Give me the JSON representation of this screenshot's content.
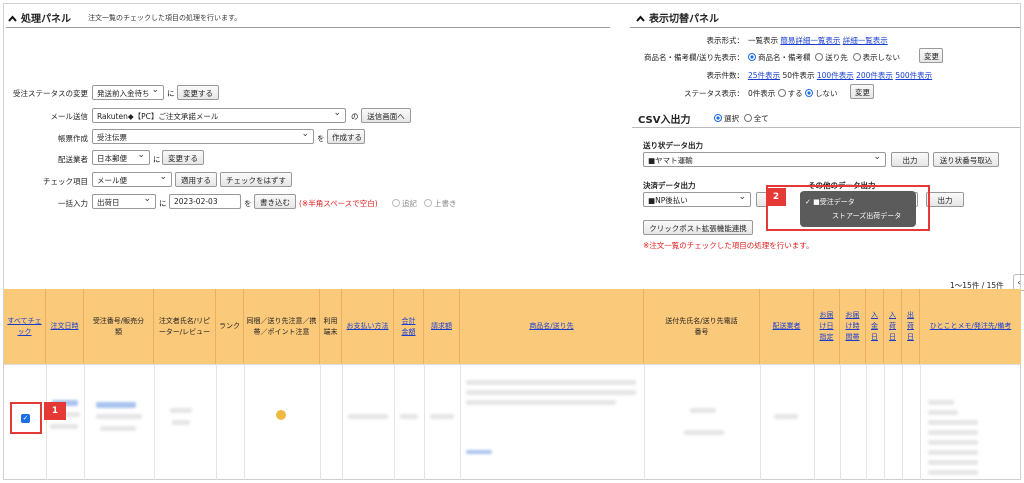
{
  "process_panel": {
    "title": "処理パネル",
    "subtitle": "注文一覧のチェックした項目の処理を行います。",
    "rows": {
      "status": {
        "label": "受注ステータスの変更",
        "select": "発送前入金待ち",
        "joiner": "に",
        "button": "変更する"
      },
      "mail": {
        "label": "メール送信",
        "select": "Rakuten◆【PC】ご注文承諾メール",
        "joiner": "の",
        "button": "送信画面へ"
      },
      "form": {
        "label": "帳票作成",
        "select": "受注伝票",
        "joiner": "を",
        "button": "作成する"
      },
      "carrier": {
        "label": "配送業者",
        "select": "日本郵便",
        "joiner": "に",
        "button": "変更する"
      },
      "check": {
        "label": "チェック項目",
        "select": "メール便",
        "button1": "適用する",
        "button2": "チェックをはずす"
      },
      "bulk": {
        "label": "一括入力",
        "select": "出荷日",
        "joiner": "に",
        "date_value": "2023-02-03",
        "joiner2": "を",
        "button": "書き込む",
        "note": "(※半角スペースで空白)",
        "radio1": "追記",
        "radio2": "上書き"
      }
    }
  },
  "display_panel": {
    "title": "表示切替パネル",
    "format": {
      "label": "表示形式：",
      "current": "一覧表示",
      "link1": "簡易詳細一覧表示",
      "link2": "詳細一覧表示"
    },
    "product": {
      "label": "商品名・備考欄/送り先表示：",
      "opt1": "商品名・備考欄",
      "opt2": "送り先",
      "opt3": "表示しない",
      "button": "変更"
    },
    "count": {
      "label": "表示件数：",
      "link1": "25件表示",
      "current": "50件表示",
      "link2": "100件表示",
      "link3": "200件表示",
      "link4": "500件表示"
    },
    "status": {
      "label": "ステータス表示：",
      "value": "0件表示",
      "opt1": "する",
      "opt2": "しない",
      "button": "変更"
    }
  },
  "csv": {
    "title": "CSV入出力",
    "opt1": "選択",
    "opt2": "全て",
    "shipping_label": "送り状データ出力",
    "shipping_select": "■ヤマト運輸",
    "output_button": "出力",
    "tracking_button": "送り状番号取込",
    "settlement_label": "決済データ出力",
    "settlement_select": "■NP後払い",
    "other_label": "その他のデータ出力",
    "other_output_button": "出力",
    "clickpost_button": "クリックポスト拡張機能連携",
    "note": "※注文一覧のチェックした項目の処理を行います。",
    "dropdown": {
      "item1": "■受注データ",
      "item2": "ストアーズ出荷データ"
    }
  },
  "pagination": {
    "text": "1〜15件 / 15件"
  },
  "table": {
    "headers": {
      "check_all": "すべてチェック",
      "order_date": "注文日時",
      "order_no": "受注番号/販売分類",
      "customer": "注文者氏名/リピーター/レビュー",
      "rank": "ランク",
      "bundle": "同梱／送り先注意／携帯／ポイント注意",
      "device": "利用端末",
      "payment": "お支払い方法",
      "total": "合計金額",
      "billing": "請求額",
      "product": "商品名/送り先",
      "ship_to": "送付先氏名/送り先電話番号",
      "carrier": "配送業者",
      "delivery_date": "お届け日指定",
      "delivery_time": "お届け時間帯",
      "pay_date": "入金日",
      "ship_in": "入荷日",
      "ship_out": "出荷日",
      "memo": "ひとことメモ/発注先/備考"
    }
  },
  "callouts": {
    "c1": "1",
    "c2": "2"
  },
  "row_icon_check": "✓",
  "dropdown_check": "✓"
}
